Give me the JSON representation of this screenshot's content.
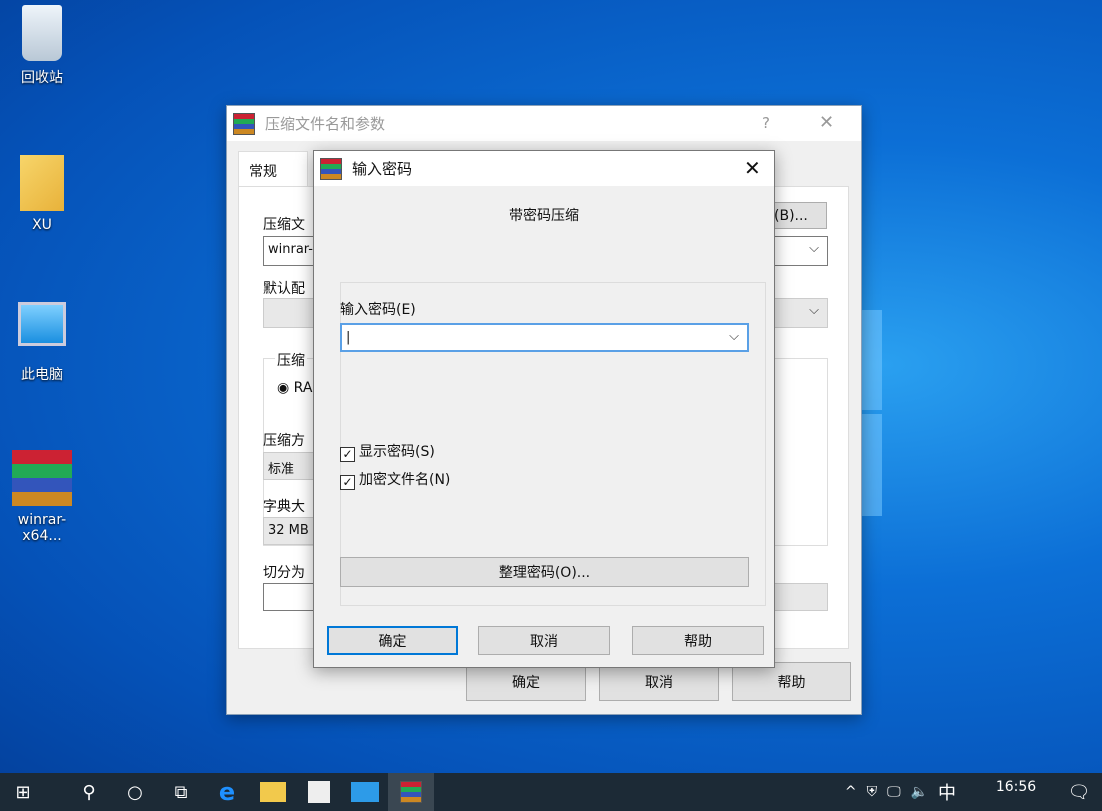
{
  "desktop": {
    "icons": [
      {
        "label": "回收站"
      },
      {
        "label": "XU"
      },
      {
        "label": "此电脑"
      },
      {
        "label": "winrar-x64..."
      }
    ]
  },
  "back_dialog": {
    "title": "压缩文件名和参数",
    "help": "?",
    "close": "✕",
    "tab": "常规",
    "archive_name_label": "压缩文",
    "archive_name_value": "winrar-",
    "browse_label": "(B)...",
    "profile_label": "默认配",
    "format_group": "压缩",
    "format_radio": "RA",
    "method_label": "压缩方",
    "method_value": "标准",
    "dict_label": "字典大",
    "dict_value": "32 MB",
    "split_label": "切分为",
    "ok": "确定",
    "cancel": "取消",
    "help_btn": "帮助"
  },
  "password_dialog": {
    "title": "输入密码",
    "close": "✕",
    "heading": "带密码压缩",
    "password_label": "输入密码(E)",
    "password_value": "",
    "show_password": {
      "label": "显示密码(S)",
      "checked": true
    },
    "encrypt_names": {
      "label": "加密文件名(N)",
      "checked": true
    },
    "organize": "整理密码(O)...",
    "ok": "确定",
    "cancel": "取消",
    "help": "帮助"
  },
  "taskbar": {
    "time": "16:56",
    "ime": "中",
    "chevron": "^"
  }
}
